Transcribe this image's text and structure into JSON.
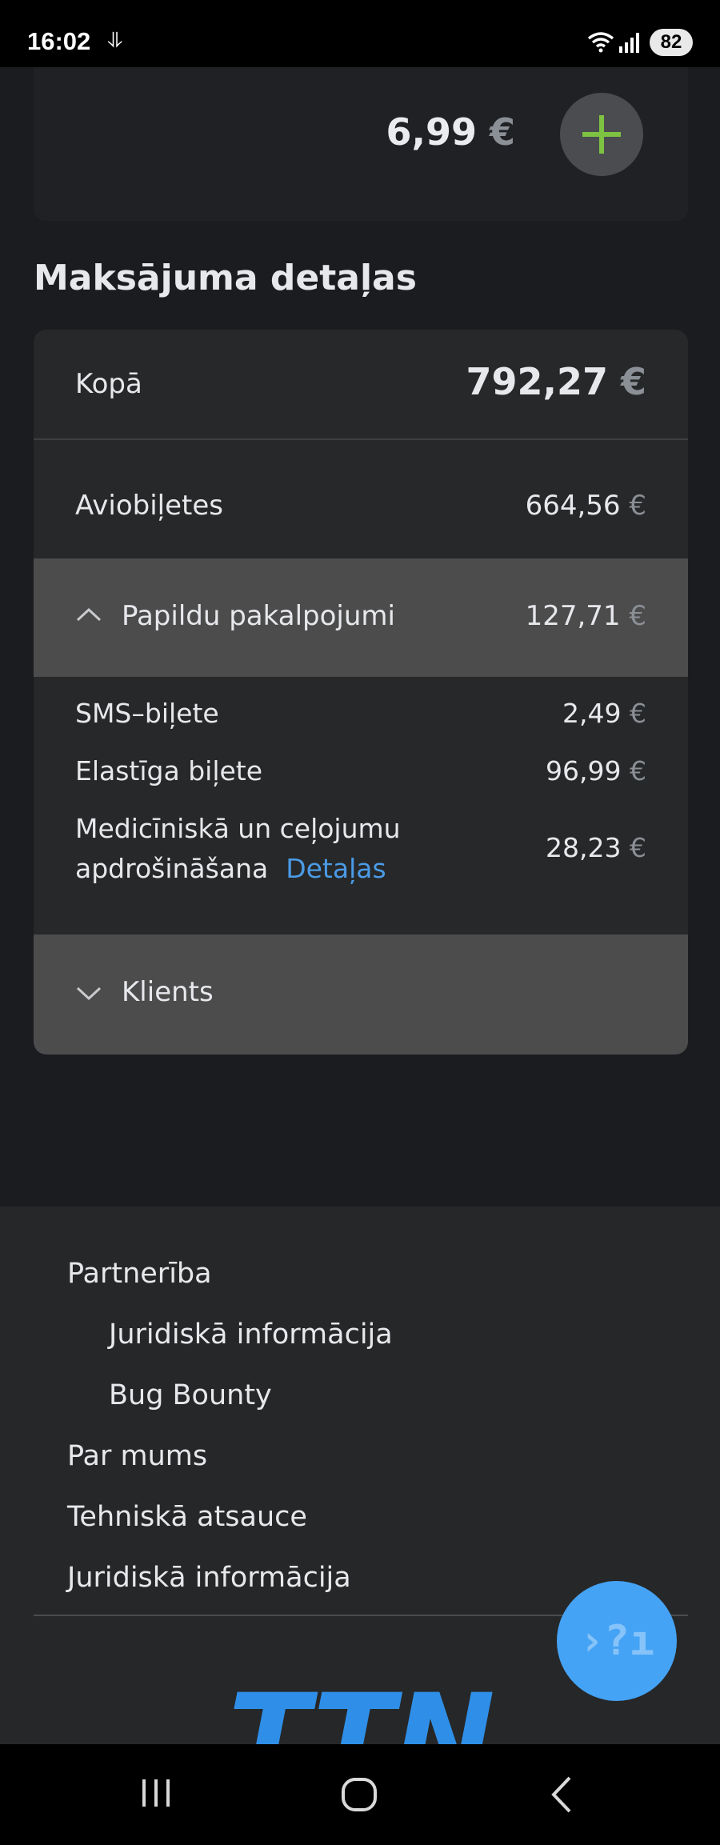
{
  "status_bar": {
    "time": "16:02",
    "battery": "82"
  },
  "top_card": {
    "price": "6,99",
    "currency": "€"
  },
  "payment": {
    "title": "Maksājuma detaļas",
    "total_label": "Kopā",
    "total_value": "792,27",
    "currency": "€",
    "tickets_label": "Aviobiļetes",
    "tickets_value": "664,56",
    "extras_label": "Papildu pakalpojumi",
    "extras_value": "127,71",
    "extras_items": [
      {
        "label": "SMS–biļete",
        "value": "2,49"
      },
      {
        "label": "Elastīga biļete",
        "value": "96,99"
      },
      {
        "label_line1": "Medicīniskā un ceļojumu",
        "label_line2": "apdrošināšana",
        "link": "Detaļas",
        "value": "28,23"
      }
    ],
    "client_label": "Klients"
  },
  "footer": {
    "links": [
      "Partnerība",
      "Juridiskā informācija",
      "Bug Bounty",
      "Par mums",
      "Tehniskā atsauce",
      "Juridiskā informācija"
    ],
    "logo_text": "TTN"
  },
  "help_button": {
    "glyph": "›?ı"
  },
  "colors": {
    "accent_green": "#7ec242",
    "link_blue": "#4b9be6",
    "fab_blue": "#45a3f5",
    "logo_blue": "#2f8fe8"
  }
}
